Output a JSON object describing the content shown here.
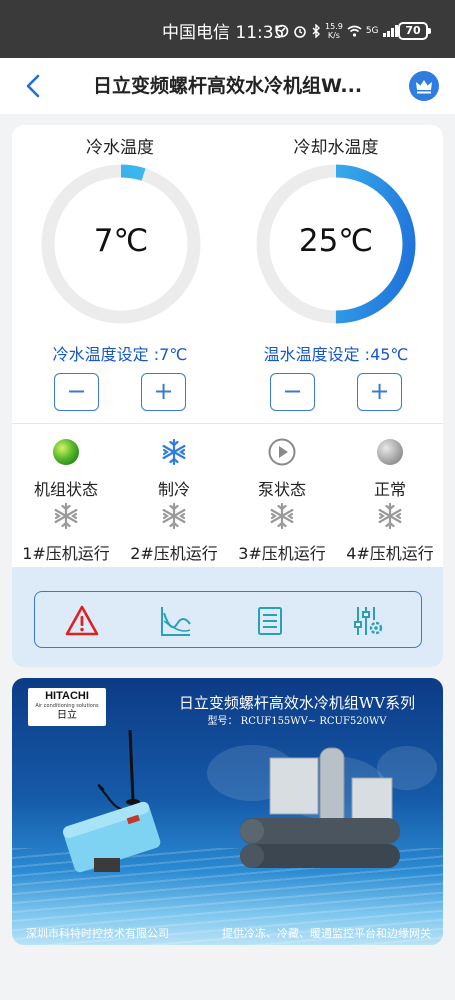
{
  "status_bar": {
    "carrier": "中国电信",
    "time": "11:35",
    "net_speed_value": "15.9",
    "net_speed_unit": "K/s",
    "signal": "5G",
    "battery": "70"
  },
  "header": {
    "title": "日立变频螺杆高效水冷机组W..."
  },
  "gauges": [
    {
      "label": "冷水温度",
      "value": "7℃",
      "level": 0.05,
      "setpoint": "冷水温度设定 :7℃",
      "minus": "−",
      "plus": "+"
    },
    {
      "label": "冷却水温度",
      "value": "25℃",
      "level": 0.5,
      "setpoint": "温水温度设定 :45℃",
      "minus": "−",
      "plus": "+"
    }
  ],
  "status_row": [
    {
      "label": "机组状态",
      "icon": "green-ball-icon"
    },
    {
      "label": "制冷",
      "icon": "snowflake-icon"
    },
    {
      "label": "泵状态",
      "icon": "play-icon"
    },
    {
      "label": "正常",
      "icon": "grey-ball-icon"
    }
  ],
  "compressor_row": [
    {
      "label": "1#压机运行",
      "icon": "snowflake-icon"
    },
    {
      "label": "2#压机运行",
      "icon": "snowflake-icon"
    },
    {
      "label": "3#压机运行",
      "icon": "snowflake-icon"
    },
    {
      "label": "4#压机运行",
      "icon": "snowflake-icon"
    }
  ],
  "toolbar": [
    {
      "icon": "alarm-icon"
    },
    {
      "icon": "curve-chart-icon"
    },
    {
      "icon": "list-icon"
    },
    {
      "icon": "settings-sliders-icon"
    }
  ],
  "banner": {
    "logo": "HITACHI",
    "logo_sub": "Air conditioning solutions",
    "logo_cn": "日立",
    "title": "日立变频螺杆高效水冷机组WV系列",
    "model": "型号： RCUF155WV~ RCUF520WV",
    "footer_left": "深圳市科特时控技术有限公司",
    "footer_right": "提供冷冻、冷藏、暖通监控平台和边缘网关"
  },
  "colors": {
    "accent": "#2f7de1",
    "gauge_track": "#ececec",
    "gauge_start": "#1e6fd9",
    "gauge_end": "#42c8f4",
    "setpoint_text": "#1558c8",
    "alarm": "#e02020",
    "tool_teal": "#2aa0b8"
  }
}
